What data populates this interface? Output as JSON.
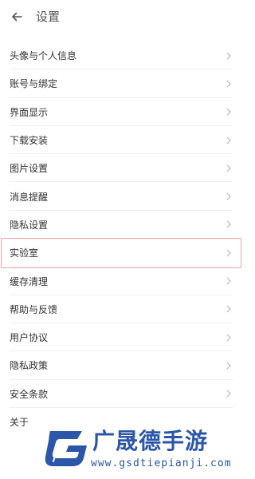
{
  "header": {
    "back_icon": "back-arrow-icon",
    "title": "设置"
  },
  "settings": {
    "items": [
      {
        "label": "头像与个人信息"
      },
      {
        "label": "账号与绑定"
      },
      {
        "label": "界面显示"
      },
      {
        "label": "下载安装"
      },
      {
        "label": "图片设置"
      },
      {
        "label": "消息提醒"
      },
      {
        "label": "隐私设置"
      },
      {
        "label": "实验室",
        "highlighted": true
      },
      {
        "label": "缓存清理"
      },
      {
        "label": "帮助与反馈"
      },
      {
        "label": "用户协议"
      },
      {
        "label": "隐私政策"
      },
      {
        "label": "安全条款"
      },
      {
        "label": "关于"
      }
    ],
    "chevron_icon": "chevron-right-icon",
    "highlight_color": "#f0a3a3"
  },
  "watermark": {
    "title": "广晟德手游",
    "url": "www.gsdtiepianji.com",
    "color": "#2c57a8"
  }
}
